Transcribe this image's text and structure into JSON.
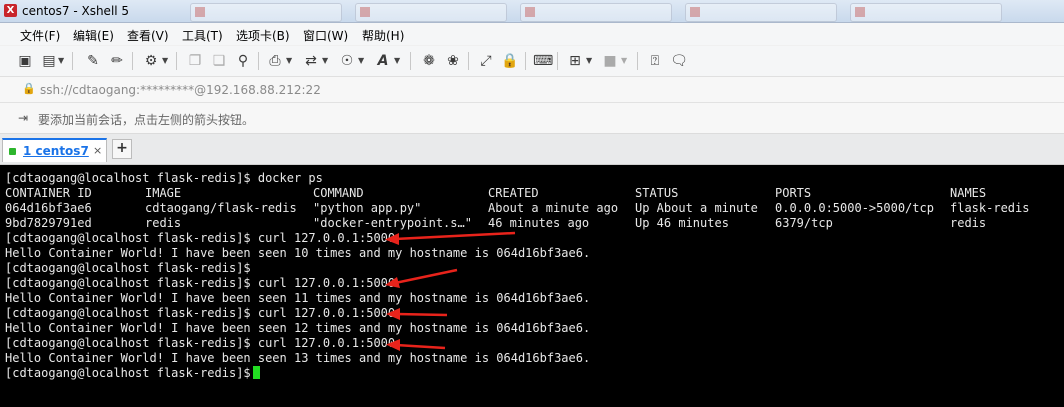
{
  "window": {
    "title": "centos7 - Xshell 5",
    "app_icon": "xshell-icon"
  },
  "menu": [
    "文件(F)",
    "编辑(E)",
    "查看(V)",
    "工具(T)",
    "选项卡(B)",
    "窗口(W)",
    "帮助(H)"
  ],
  "address": {
    "icon": "lock-icon",
    "text": "ssh://cdtaogang:*********@192.168.88.212:22"
  },
  "hint": {
    "icon": "arrow-icon",
    "text": "要添加当前会话，点击左侧的箭头按钮。"
  },
  "tabs": {
    "active_label": "1 centos7",
    "close": "×",
    "new_tab": "+"
  },
  "terminal": {
    "cmd_docker_ps": "[cdtaogang@localhost flask-redis]$ docker ps",
    "ps_headers": [
      "CONTAINER ID",
      "IMAGE",
      "COMMAND",
      "CREATED",
      "STATUS",
      "PORTS",
      "NAMES"
    ],
    "ps_rows": [
      [
        "064d16bf3ae6",
        "cdtaogang/flask-redis",
        "\"python app.py\"",
        "About a minute ago",
        "Up About a minute",
        "0.0.0.0:5000->5000/tcp",
        "flask-redis"
      ],
      [
        "9bd7829791ed",
        "redis",
        "\"docker-entrypoint.s…\"",
        "46 minutes ago",
        "Up 46 minutes",
        "6379/tcp",
        "redis"
      ]
    ],
    "lines": [
      "[cdtaogang@localhost flask-redis]$ curl 127.0.0.1:5000",
      "Hello Container World! I have been seen 10 times and my hostname is 064d16bf3ae6.",
      "[cdtaogang@localhost flask-redis]$",
      "[cdtaogang@localhost flask-redis]$ curl 127.0.0.1:5000",
      "Hello Container World! I have been seen 11 times and my hostname is 064d16bf3ae6.",
      "[cdtaogang@localhost flask-redis]$ curl 127.0.0.1:5000",
      "Hello Container World! I have been seen 12 times and my hostname is 064d16bf3ae6.",
      "[cdtaogang@localhost flask-redis]$ curl 127.0.0.1:5000",
      "Hello Container World! I have been seen 13 times and my hostname is 064d16bf3ae6.",
      "[cdtaogang@localhost flask-redis]$"
    ]
  },
  "colors": {
    "terminal_bg": "#000000",
    "terminal_fg": "#e8e8e8",
    "cursor": "#22dd22",
    "annotation_arrow": "#e8231b",
    "tab_accent": "#1a73e8"
  }
}
